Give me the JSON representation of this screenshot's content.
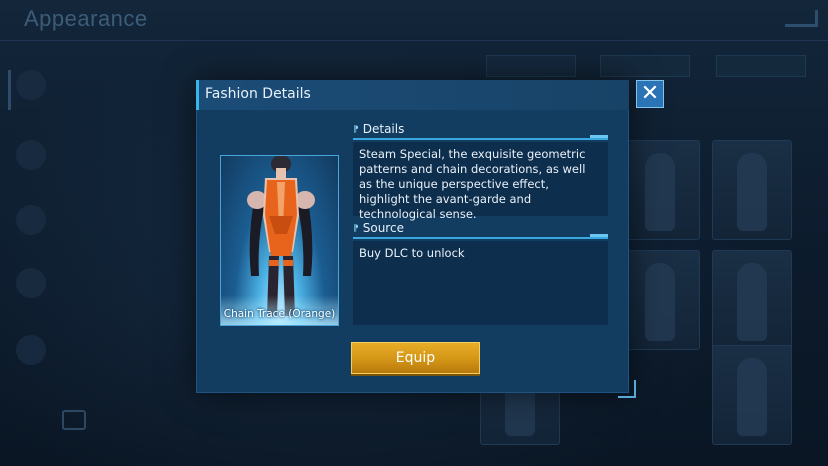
{
  "background": {
    "screen_title": "Appearance"
  },
  "modal": {
    "title": "Fashion Details",
    "close_glyph": "✕",
    "item_name": "Chain Trace (Orange)",
    "details": {
      "label": "Details",
      "text": "Steam Special, the exquisite geometric patterns and chain decorations, as well as the unique perspective effect, highlight the avant-garde and technological sense."
    },
    "source": {
      "label": "Source",
      "text": "Buy DLC to unlock"
    },
    "equip_label": "Equip",
    "section_marker": "⁋"
  },
  "colors": {
    "accent": "#38b6e8",
    "button_gold": "#d39516",
    "outfit_orange": "#e8641c"
  },
  "icons": {
    "close": "close-icon",
    "camera": "camera-icon",
    "outfit": "outfit-icon"
  }
}
